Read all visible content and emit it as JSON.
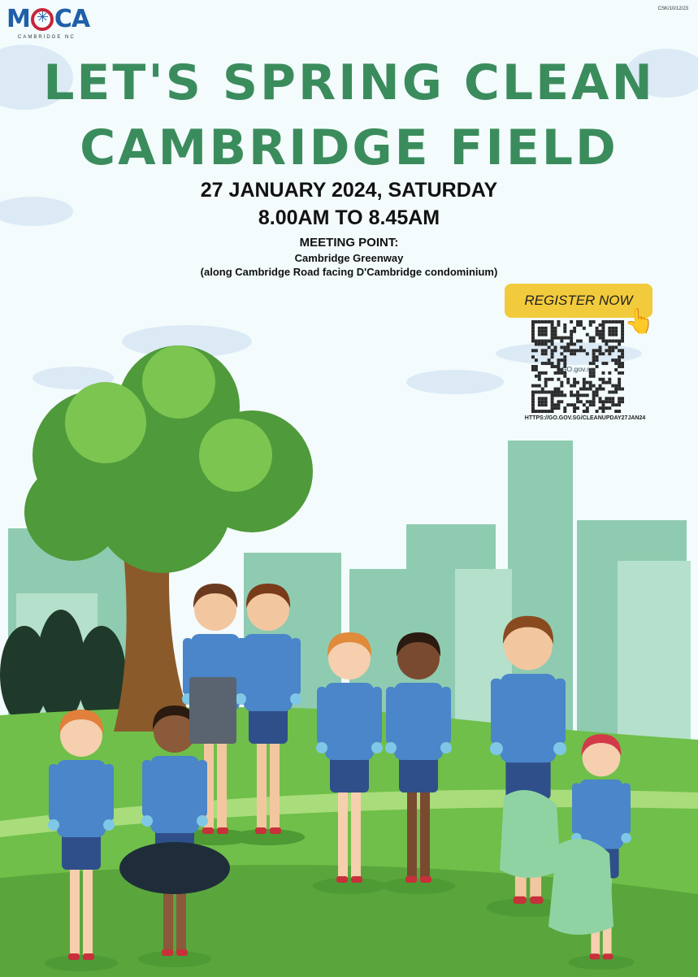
{
  "header": {
    "logo_text": "MOCA",
    "logo_subtext": "CAMBRIDGE NC",
    "document_code": "CSK/10/12/23"
  },
  "event": {
    "title_line1": "LET'S SPRING CLEAN",
    "title_line2": "CAMBRIDGE FIELD",
    "date": "27 JANUARY 2024, SATURDAY",
    "time": "8.00AM TO 8.45AM",
    "meeting_point_label": "MEETING POINT:",
    "meeting_point_name": "Cambridge Greenway",
    "meeting_point_detail": "(along Cambridge Road facing D'Cambridge condominium)"
  },
  "registration": {
    "button_label": "REGISTER NOW",
    "qr_center_label": "GO.gov.sg",
    "url": "HTTPS://GO.GOV.SG/CLEANUPDAY27JAN24",
    "icons": [
      "pointing-hand-icon",
      "qr-code-icon"
    ]
  },
  "colors": {
    "title_green": "#3b8c5c",
    "button_yellow": "#f2cb3c",
    "logo_blue": "#1f5fa8",
    "logo_red": "#c8243a",
    "shirt_blue": "#4a86c9",
    "grass": "#6fbf4a",
    "skyline": "#8fcbb0"
  }
}
